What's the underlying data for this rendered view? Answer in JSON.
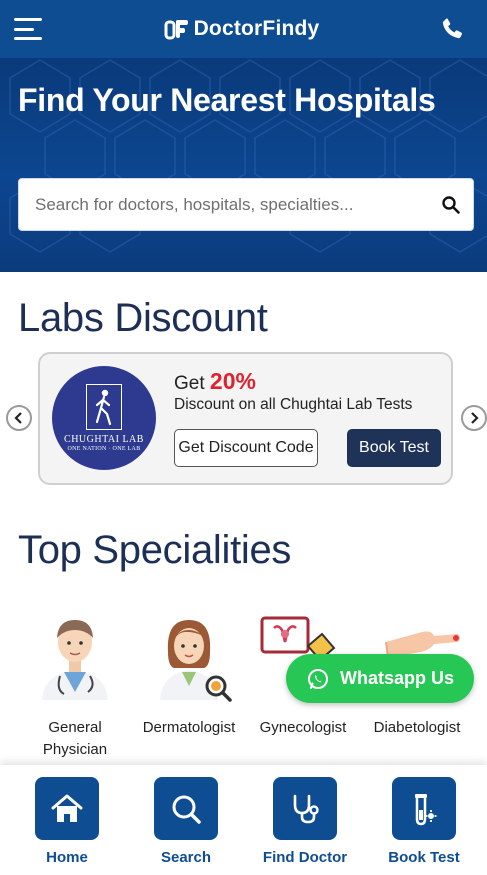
{
  "header": {
    "brand": "DoctorFindy",
    "menu_icon": "hamburger-menu-icon",
    "phone_icon": "phone-icon"
  },
  "hero": {
    "title": "Find Your Nearest Hospitals",
    "search": {
      "placeholder": "Search for doctors, hospitals, specialties...",
      "value": ""
    }
  },
  "labs": {
    "heading": "Labs Discount",
    "card": {
      "lab_name": "CHUGHTAI LAB",
      "lab_tagline": "ONE NATION · ONE LAB",
      "get_label": "Get",
      "discount": "20%",
      "description": "Discount on all Chughtai Lab Tests",
      "discount_button": "Get Discount Code",
      "book_button": "Book Test"
    }
  },
  "specialities": {
    "heading": "Top Specialities",
    "items": [
      {
        "label": "General Physician",
        "icon": "doctor-icon"
      },
      {
        "label": "Dermatologist",
        "icon": "dermatologist-icon"
      },
      {
        "label": "Gynecologist",
        "icon": "gynecology-icon"
      },
      {
        "label": "Diabetologist",
        "icon": "diabetes-icon"
      }
    ]
  },
  "whatsapp": {
    "label": "Whatsapp Us"
  },
  "bottom_nav": {
    "items": [
      {
        "label": "Home",
        "icon": "home-icon"
      },
      {
        "label": "Search",
        "icon": "search-icon"
      },
      {
        "label": "Find Doctor",
        "icon": "stethoscope-icon"
      },
      {
        "label": "Book Test",
        "icon": "test-tube-icon"
      }
    ]
  },
  "colors": {
    "primary": "#0f4d92",
    "accent_red": "#e0222f",
    "whatsapp_green": "#27c755",
    "dark_button": "#1f3359"
  }
}
